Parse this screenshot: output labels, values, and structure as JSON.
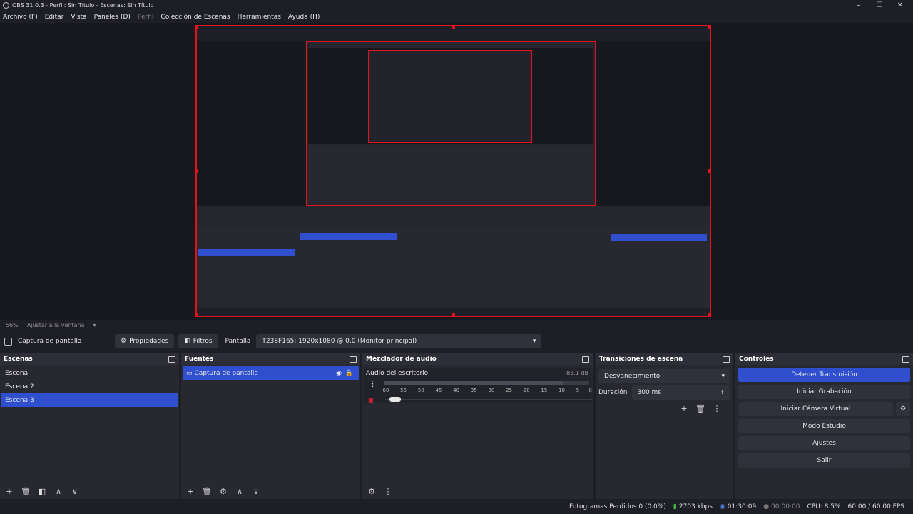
{
  "window": {
    "title": "OBS 31.0.3 - Perfil: Sin Título - Escenas: Sin Título",
    "min": "–",
    "max": "☐",
    "close": "✕"
  },
  "menu": {
    "items": [
      "Archivo (F)",
      "Editar",
      "Vista",
      "Paneles (D)",
      "Perfil",
      "Colección de Escenas",
      "Herramientas",
      "Ayuda (H)"
    ]
  },
  "zoom": {
    "percent": "56%",
    "fit_label": "Ajustar a la ventana"
  },
  "source_bar": {
    "name": "Captura de pantalla",
    "properties": "Propiedades",
    "filters": "Filtros",
    "display_label": "Pantalla",
    "display_value": "T238F165: 1920x1080 @ 0,0 (Monitor principal)"
  },
  "scenes": {
    "title": "Escenas",
    "items": [
      "Escena",
      "Escena 2",
      "Escena 3"
    ],
    "selected_index": 2
  },
  "sources": {
    "title": "Fuentes",
    "items": [
      "Captura de pantalla"
    ]
  },
  "mixer": {
    "title": "Mezclador de audio",
    "track": "Audio del escritorio",
    "level": "-83.1 dB",
    "ticks": [
      "-60",
      "-55",
      "-50",
      "-45",
      "-40",
      "-35",
      "-30",
      "-25",
      "-20",
      "-15",
      "-10",
      "-5",
      "0"
    ]
  },
  "transitions": {
    "title": "Transiciones de escena",
    "selected": "Desvanecimiento",
    "duration_label": "Duración",
    "duration_value": "300 ms"
  },
  "controls": {
    "title": "Controles",
    "buttons": [
      "Detener Transmisión",
      "Iniciar Grabación",
      "Iniciar Cámara Virtual",
      "Modo Estudio",
      "Ajustes",
      "Salir"
    ]
  },
  "status": {
    "dropped": "Fotogramas Perdidos 0 (0.0%)",
    "bitrate": "2703 kbps",
    "stream_time": "01:30:09",
    "rec_time": "00:00:00",
    "cpu": "CPU: 8.5%",
    "fps": "60.00 / 60.00 FPS"
  },
  "colors": {
    "accent": "#2f4fcf",
    "selection_red": "#e0141f"
  }
}
